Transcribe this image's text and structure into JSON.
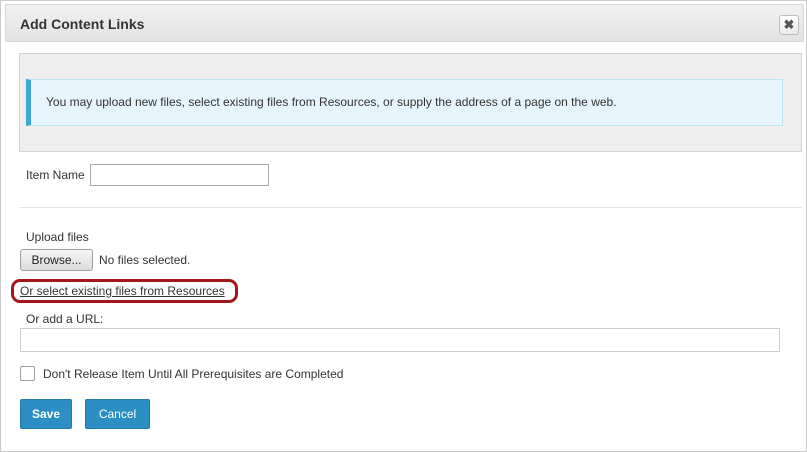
{
  "dialog": {
    "title": "Add Content Links",
    "close_icon": "close-icon",
    "close_glyph": "✖"
  },
  "info": {
    "message": "You may upload new files, select existing files from Resources, or supply the address of a page on the web."
  },
  "form": {
    "item_name_label": "Item Name",
    "item_name_value": "",
    "upload_label": "Upload files",
    "browse_label": "Browse...",
    "no_files_text": "No files selected.",
    "resources_link": "Or select existing files from Resources",
    "url_label": "Or add a URL:",
    "url_value": "",
    "prereq_label": "Don't Release Item Until All Prerequisites are Completed",
    "prereq_checked": false
  },
  "actions": {
    "save_label": "Save",
    "cancel_label": "Cancel"
  },
  "colors": {
    "primary_button": "#2b8fc4",
    "info_background": "#e6f4fb",
    "info_accent": "#3fa7d6",
    "highlight_ring": "#a3171c"
  }
}
